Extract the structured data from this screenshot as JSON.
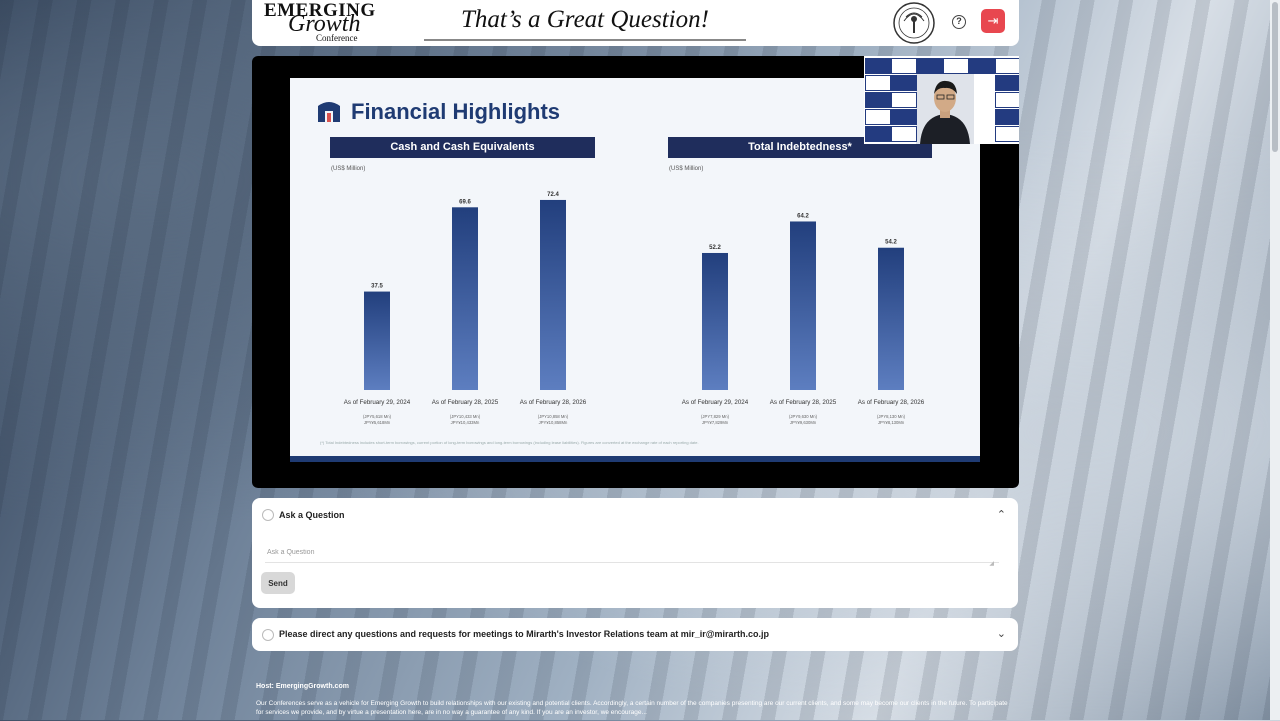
{
  "header": {
    "logo": {
      "line1": "EMERGING",
      "line2": "Growth",
      "line3": "Conference"
    },
    "tagline": "That’s a Great Question!",
    "seal_icon": "conference-seal-icon",
    "help_icon": "help-icon",
    "exit_icon": "exit-icon"
  },
  "slide": {
    "title": "Financial Highlights",
    "charts": [
      {
        "heading": "Cash and Cash Equivalents",
        "unit": "(US$ Million)"
      },
      {
        "heading": "Total Indebtedness*",
        "unit": "(US$ Million)"
      }
    ],
    "footnote": "(*) Total Indebtedness includes short-term borrowings, current portion of long-term borrowings and long-term borrowings (including lease liabilities). Figures are converted at the exchange rate of each reporting date."
  },
  "chart_data": [
    {
      "type": "bar",
      "title": "Cash and Cash Equivalents",
      "ylabel": "(US$ Million)",
      "categories": [
        "As of February 29, 2024",
        "As of February 28, 2025",
        "As of February 28, 2026"
      ],
      "values": [
        37.5,
        69.6,
        72.4
      ],
      "value_labels": [
        "37.5",
        "69.6",
        "72.4"
      ],
      "sub_labels": [
        "(JPY5,618 Mn) JPY¥5,618Mn",
        "(JPY10,433 Mn) JPY¥10,433Mn",
        "(JPY10,858 Mn) JPY¥10,858Mn"
      ],
      "ylim": [
        0,
        80
      ],
      "colors": {
        "bar_top": "#223f7d",
        "bar_bottom": "#5d7ec0"
      }
    },
    {
      "type": "bar",
      "title": "Total Indebtedness*",
      "ylabel": "(US$ Million)",
      "categories": [
        "As of February 29, 2024",
        "As of February 28, 2025",
        "As of February 28, 2026"
      ],
      "values": [
        52.2,
        64.2,
        54.2
      ],
      "value_labels": [
        "52.2",
        "64.2",
        "54.2"
      ],
      "sub_labels": [
        "(JPY7,829 Mn) JPY¥7,829Mn",
        "(JPY9,630 Mn) JPY¥9,630Mn",
        "(JPY8,130 Mn) JPY¥8,130Mn"
      ],
      "ylim": [
        0,
        80
      ],
      "colors": {
        "bar_top": "#223f7d",
        "bar_bottom": "#5d7ec0"
      }
    }
  ],
  "question_panel": {
    "title": "Ask a Question",
    "placeholder": "Ask a Question",
    "send_label": "Send",
    "collapse_icon": "chevron-up-icon"
  },
  "investor_panel": {
    "title": "Please direct any questions and requests for meetings to Mirarth's Investor Relations team at mir_ir@mirarth.co.jp",
    "expand_icon": "chevron-down-icon"
  },
  "footer": {
    "line1": "Host: EmergingGrowth.com",
    "line2": "Our Conferences serve as a vehicle for Emerging Growth to build relationships with our existing and potential clients. Accordingly, a certain number of the companies presenting are our current clients, and some may become our clients in the future. To participate for services we provide, and by virtue a presentation here, are in no way a guarantee of any kind. If you are an investor, we encourage..."
  }
}
